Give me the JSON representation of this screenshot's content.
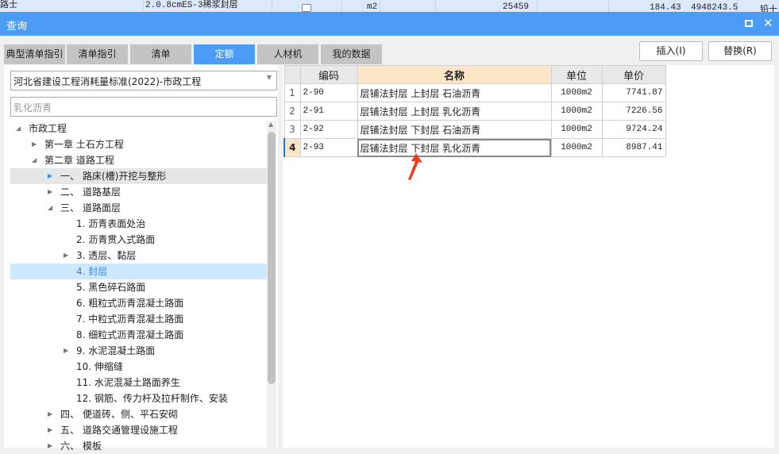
{
  "background_row": {
    "cells": [
      "路士",
      "2.0.8cmES-3稀浆封层",
      "m2",
      "25459",
      "184.43",
      "4948243.5",
      "铅十"
    ]
  },
  "dialog": {
    "title": "查询"
  },
  "tabs": [
    {
      "label": "典型清单指引"
    },
    {
      "label": "清单指引"
    },
    {
      "label": "清单"
    },
    {
      "label": "定额",
      "active": true
    },
    {
      "label": "人材机"
    },
    {
      "label": "我的数据"
    }
  ],
  "buttons": {
    "insert": "插入(I)",
    "replace": "替换(R)"
  },
  "left": {
    "standard": "河北省建设工程消耗量标准(2022)-市政工程",
    "search_value": "乳化沥青",
    "tree": [
      {
        "label": "市政工程",
        "level": 0,
        "state": "open"
      },
      {
        "label": "第一章 土石方工程",
        "level": 1,
        "state": "closed"
      },
      {
        "label": "第二章 道路工程",
        "level": 1,
        "state": "open"
      },
      {
        "prefix": "一、",
        "label": "路床(槽)开挖与整形",
        "level": 2,
        "state": "closed",
        "hover": true
      },
      {
        "prefix": "二、",
        "label": "道路基层",
        "level": 2,
        "state": "closed"
      },
      {
        "prefix": "三、",
        "label": "道路面层",
        "level": 2,
        "state": "open"
      },
      {
        "label": "1. 沥青表面处治",
        "level": 3,
        "state": "leaf"
      },
      {
        "label": "2. 沥青贯入式路面",
        "level": 3,
        "state": "leaf"
      },
      {
        "label": "3. 透层、黏层",
        "level": 3,
        "state": "closed"
      },
      {
        "label": "4. 封层",
        "level": 3,
        "state": "leaf",
        "selected": true
      },
      {
        "label": "5. 黑色碎石路面",
        "level": 3,
        "state": "leaf"
      },
      {
        "label": "6. 粗粒式沥青混凝土路面",
        "level": 3,
        "state": "leaf"
      },
      {
        "label": "7. 中粒式沥青混凝土路面",
        "level": 3,
        "state": "leaf"
      },
      {
        "label": "8. 细粒式沥青混凝土路面",
        "level": 3,
        "state": "leaf"
      },
      {
        "label": "9. 水泥混凝土路面",
        "level": 3,
        "state": "closed"
      },
      {
        "label": "10. 伸缩缝",
        "level": 3,
        "state": "leaf"
      },
      {
        "label": "11. 水泥混凝土路面养生",
        "level": 3,
        "state": "leaf"
      },
      {
        "label": "12. 钢筋、传力杆及拉杆制作、安装",
        "level": 3,
        "state": "leaf"
      },
      {
        "prefix": "四、",
        "label": "便道砖、侧、平石安砌",
        "level": 2,
        "state": "closed"
      },
      {
        "prefix": "五、",
        "label": "道路交通管理设施工程",
        "level": 2,
        "state": "closed"
      },
      {
        "prefix": "六、",
        "label": "模板",
        "level": 2,
        "state": "closed"
      }
    ]
  },
  "table": {
    "headers": [
      "编码",
      "名称",
      "单位",
      "单价"
    ],
    "rows": [
      {
        "no": "1",
        "code": "2-90",
        "name": "层铺法封层 上封层 石油沥青",
        "unit": "1000m2",
        "price": "7741.87"
      },
      {
        "no": "2",
        "code": "2-91",
        "name": "层铺法封层 上封层 乳化沥青",
        "unit": "1000m2",
        "price": "7226.56"
      },
      {
        "no": "3",
        "code": "2-92",
        "name": "层铺法封层 下封层 石油沥青",
        "unit": "1000m2",
        "price": "9724.24"
      },
      {
        "no": "4",
        "code": "2-93",
        "name": "层铺法封层 下封层 乳化沥青",
        "unit": "1000m2",
        "price": "8987.41",
        "current": true
      }
    ]
  },
  "colors": {
    "title_bar": "#4b9cf6",
    "header_active": "#fde6c8",
    "selection": "#cde8ff",
    "arrow": "#f03a1e"
  }
}
